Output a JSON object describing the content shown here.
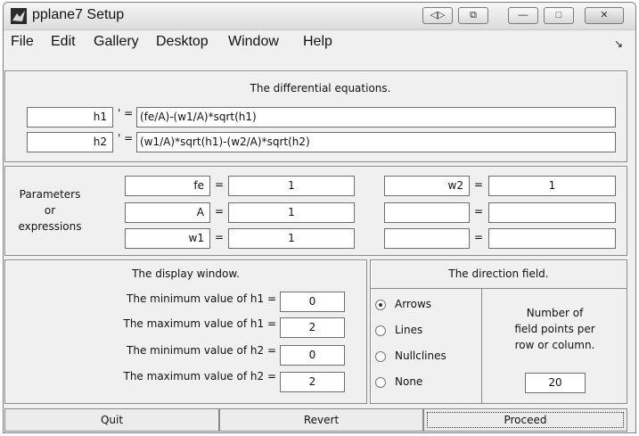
{
  "window": {
    "title": "pplane7 Setup"
  },
  "titlebar_buttons": {
    "dock": "◁▷",
    "undock": "⧉",
    "minimize": "—",
    "maximize": "□",
    "close": "✕"
  },
  "menu": [
    "File",
    "Edit",
    "Gallery",
    "Desktop",
    "Window",
    "Help"
  ],
  "dock_arrow": "↘",
  "equations": {
    "caption": "The differential equations.",
    "prime_eq": "' =",
    "rows": [
      {
        "var": "h1",
        "expr": "(fe/A)-(w1/A)*sqrt(h1)"
      },
      {
        "var": "h2",
        "expr": "(w1/A)*sqrt(h1)-(w2/A)*sqrt(h2)"
      }
    ]
  },
  "parameters": {
    "label_lines": [
      "Parameters",
      "or",
      "expressions"
    ],
    "eq": "=",
    "left": [
      {
        "name": "fe",
        "value": "1"
      },
      {
        "name": "A",
        "value": "1"
      },
      {
        "name": "w1",
        "value": "1"
      }
    ],
    "right": [
      {
        "name": "w2",
        "value": "1"
      },
      {
        "name": "",
        "value": ""
      },
      {
        "name": "",
        "value": ""
      }
    ]
  },
  "display_window": {
    "caption": "The display window.",
    "rows": [
      {
        "label": "The minimum value of h1 =",
        "value": "0"
      },
      {
        "label": "The maximum value of h1 =",
        "value": "2"
      },
      {
        "label": "The minimum value of h2 =",
        "value": "0"
      },
      {
        "label": "The maximum value of h2 =",
        "value": "2"
      }
    ]
  },
  "direction_field": {
    "caption": "The direction field.",
    "options": [
      "Arrows",
      "Lines",
      "Nullclines",
      "None"
    ],
    "selected": "Arrows",
    "points_label_lines": [
      "Number of",
      "field points per",
      "row or column."
    ],
    "points_value": "20"
  },
  "buttons": {
    "quit": "Quit",
    "revert": "Revert",
    "proceed": "Proceed"
  }
}
